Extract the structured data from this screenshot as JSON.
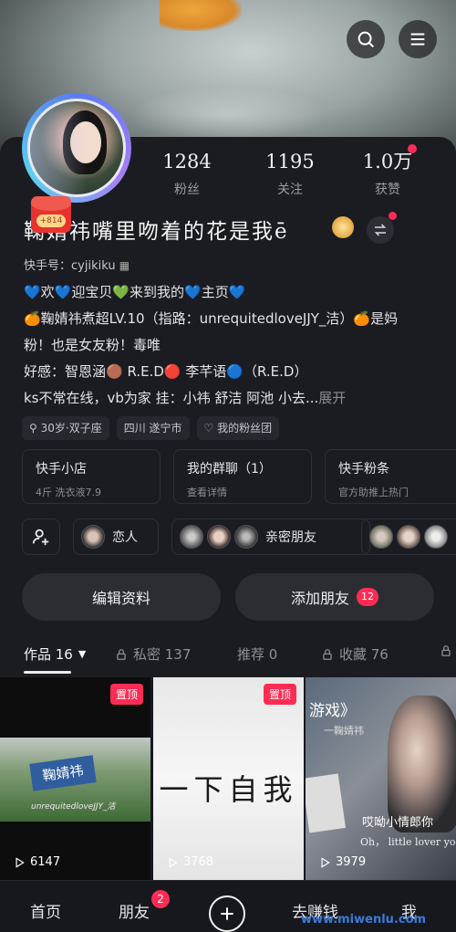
{
  "stats": [
    {
      "value": "1284",
      "label": "粉丝"
    },
    {
      "value": "1195",
      "label": "关注"
    },
    {
      "value": "1.0万",
      "label": "获赞"
    }
  ],
  "profile": {
    "gift_badge": "+814",
    "name": "鞠婧祎嘴里吻着的花是我ē",
    "ks_id": "快手号：cyjikiku",
    "bio_lines": [
      "💙欢💙迎宝贝💚来到我的💙主页💙",
      "🍊鞠婧祎煮超LV.10（指路：unrequitedloveJJY_洁）🍊是妈",
      "粉！也是女友粉！毒唯",
      "好感：智恩涵🟤 R.E.D🔴 李芊语🔵（R.E.D）"
    ],
    "bio_last": "ks不常在线，vb为家 挂：小祎 舒洁 阿池 小去...",
    "bio_more": "展开"
  },
  "tags": [
    "30岁·双子座",
    "四川 遂宁市",
    "我的粉丝团"
  ],
  "cards": [
    {
      "title": "快手小店",
      "sub": "4斤 洗衣液7.9"
    },
    {
      "title": "我的群聊（1）",
      "sub": "查看详情"
    },
    {
      "title": "快手粉条",
      "sub": "官方助推上热门"
    }
  ],
  "friends": [
    {
      "label": "恋人"
    },
    {
      "label": "亲密朋友"
    }
  ],
  "buttons": {
    "edit": "编辑资料",
    "add_friend": "添加朋友",
    "add_friend_count": "12"
  },
  "tabs": [
    {
      "label": "作品 16"
    },
    {
      "label": "私密 137"
    },
    {
      "label": "推荐 0"
    },
    {
      "label": "收藏 76"
    }
  ],
  "videos": [
    {
      "pin": "置顶",
      "caption": "鞠婧祎",
      "sub": "unrequitedloveJJY_洁",
      "views": "6147"
    },
    {
      "pin": "置顶",
      "caption": "一下自我",
      "views": "3768"
    },
    {
      "caption_top": "游戏》",
      "caption_sub": "一鞠婧祎",
      "caption_cn": "哎呦小情郎你",
      "caption_en": "Oh， little lover yo",
      "views": "3979"
    }
  ],
  "nav": [
    {
      "label": "首页"
    },
    {
      "label": "朋友"
    },
    {
      "label": "去赚钱"
    },
    {
      "label": "我"
    }
  ],
  "nav_badge": "2",
  "watermark": "www.miwenlu.com",
  "colors": {
    "accent": "#fe2c55",
    "background": "#161820"
  }
}
